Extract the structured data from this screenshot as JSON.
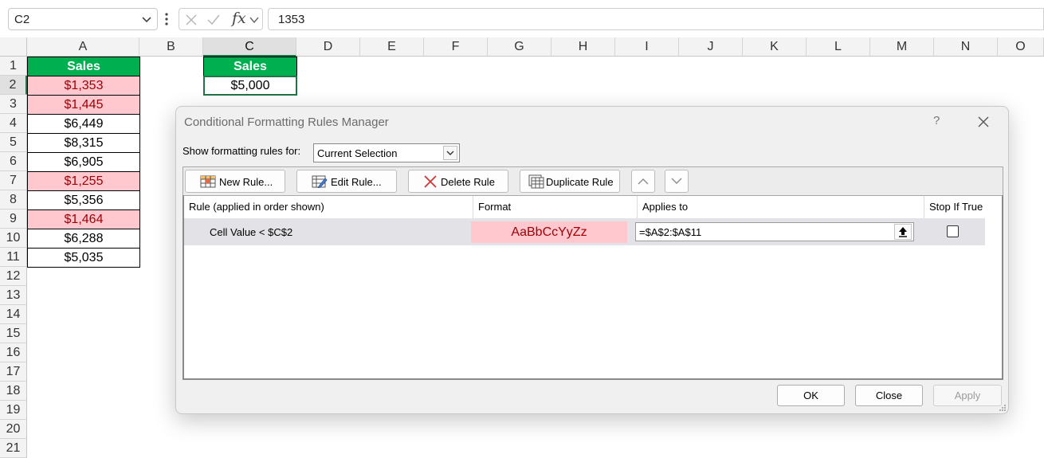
{
  "formula_bar": {
    "name_box": "C2",
    "fx": "fx",
    "formula": "1353"
  },
  "columns": [
    "A",
    "B",
    "C",
    "D",
    "E",
    "F",
    "G",
    "H",
    "I",
    "J",
    "K",
    "L",
    "M",
    "N",
    "O"
  ],
  "rows": [
    "1",
    "2",
    "3",
    "4",
    "5",
    "6",
    "7",
    "8",
    "9",
    "10",
    "11",
    "12",
    "13",
    "14",
    "15",
    "16",
    "17",
    "18",
    "19",
    "20",
    "21"
  ],
  "sheet": {
    "sales_header": "Sales",
    "sales_values": [
      "$1,353",
      "$1,445",
      "$6,449",
      "$8,315",
      "$6,905",
      "$1,255",
      "$5,356",
      "$1,464",
      "$6,288",
      "$5,035"
    ],
    "threshold_header": "Sales",
    "threshold_value": "$5,000"
  },
  "colors": {
    "header_fill": "#00b050",
    "highlight_fill": "#ffc7ce",
    "highlight_text": "#9c0006",
    "selection": "#217346"
  },
  "dialog": {
    "title": "Conditional Formatting Rules Manager",
    "help": "?",
    "show_label": "Show formatting rules for:",
    "show_value": "Current Selection",
    "toolbar": {
      "new_rule": "New Rule...",
      "edit_rule": "Edit Rule...",
      "delete_rule": "Delete Rule",
      "duplicate_rule": "Duplicate Rule"
    },
    "columns": {
      "rule": "Rule (applied in order shown)",
      "format": "Format",
      "applies": "Applies to",
      "stop": "Stop If True"
    },
    "rule": {
      "text": "Cell Value < $C$2",
      "preview": "AaBbCcYyZz",
      "applies_to": "=$A$2:$A$11",
      "stop_if_true": false
    },
    "buttons": {
      "ok": "OK",
      "close": "Close",
      "apply": "Apply"
    }
  }
}
